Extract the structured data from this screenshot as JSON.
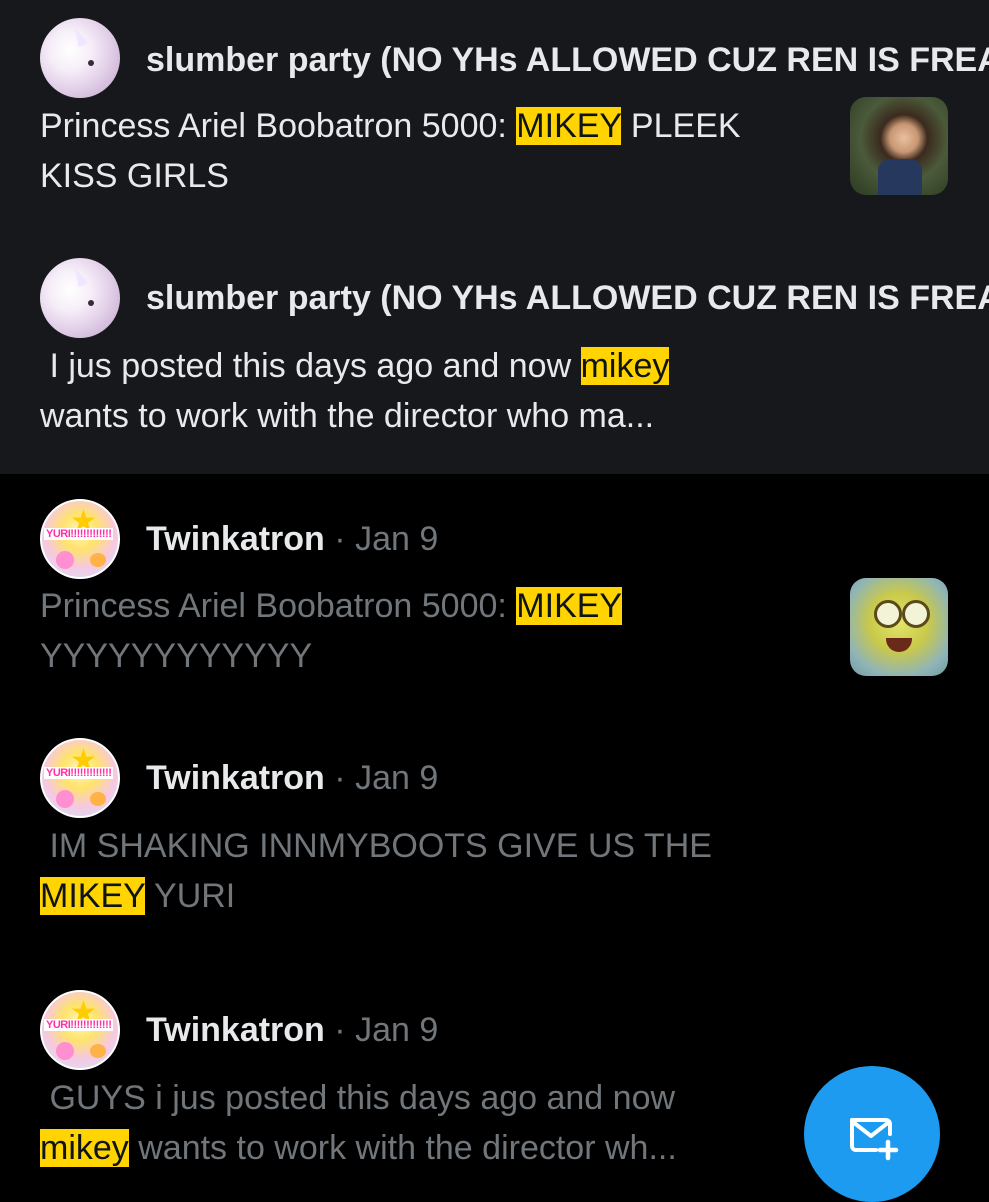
{
  "results": [
    {
      "style": "unread",
      "avatar_icon": "unicorn-plush-avatar",
      "name": "slumber party (NO YHs ALLOWED CUZ REN IS FREAKY)",
      "date": "",
      "text_before": "Princess Ariel Boobatron 5000: ",
      "highlight": "MIKEY",
      "text_after": " PLEEK\nKISS GIRLS",
      "thumbnail_icon": "boy-photo-thumbnail"
    },
    {
      "style": "unread",
      "avatar_icon": "unicorn-plush-avatar",
      "name": "slumber party (NO YHs ALLOWED CUZ REN IS FREAKY)",
      "date": "",
      "text_before": " I jus posted this days ago and now ",
      "highlight": "mikey",
      "text_after": "\nwants to work with the director who ma...",
      "thumbnail_icon": ""
    },
    {
      "style": "read",
      "avatar_icon": "yuri-sticker-avatar",
      "name": "Twinkatron",
      "date": "Jan 9",
      "text_before": "Princess Ariel Boobatron 5000: ",
      "highlight": "MIKEY",
      "text_after": "\nYYYYYYYYYYYY",
      "thumbnail_icon": "spongebob-photo-thumbnail"
    },
    {
      "style": "read",
      "avatar_icon": "yuri-sticker-avatar",
      "name": "Twinkatron",
      "date": "Jan 9",
      "text_before": " IM SHAKING INNMYBOOTS GIVE US THE\n",
      "highlight": "MIKEY",
      "text_after": " YURI",
      "thumbnail_icon": ""
    },
    {
      "style": "read",
      "avatar_icon": "yuri-sticker-avatar",
      "name": "Twinkatron",
      "date": "Jan 9",
      "text_before": " GUYS i jus posted this days ago and now\n",
      "highlight": "mikey",
      "text_after": " wants to work with the director wh...",
      "thumbnail_icon": ""
    }
  ],
  "avatar_sticker_text": "YURI!!!!!!!!!!!!!",
  "separator": "·",
  "fab": {
    "icon": "new-message-icon"
  },
  "colors": {
    "background": "#000000",
    "unread_background": "#16181c",
    "highlight": "#ffd400",
    "primary_text": "#e7e9ea",
    "secondary_text": "#71767b",
    "accent": "#1d9bf0"
  }
}
